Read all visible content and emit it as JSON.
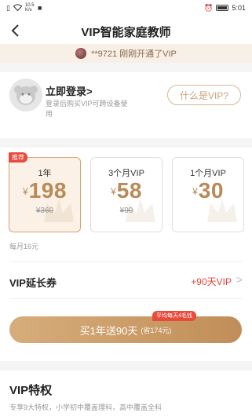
{
  "status_bar": {
    "left_icons": [
      "document-icon",
      "wifi-icon",
      "network-speed-icon",
      "notification-icon"
    ],
    "network_speed": "10.5\nK/s",
    "right_icons": [
      "alarm-icon",
      "battery-icon"
    ],
    "time": "5:01"
  },
  "header": {
    "title": "VIP智能家庭教师"
  },
  "notice": {
    "text": "**9721 刚刚开通了VIP"
  },
  "login": {
    "title": "立即登录>",
    "description": "登录后购买VIP可跨设备使用",
    "what_is_vip": "什么是VIP?"
  },
  "plans": [
    {
      "name": "1年",
      "currency": "¥",
      "price": "198",
      "original": "¥360",
      "badge": "推荐",
      "selected": true
    },
    {
      "name": "3个月VIP",
      "currency": "¥",
      "price": "58",
      "original": "¥90",
      "selected": false
    },
    {
      "name": "1个月VIP",
      "currency": "¥",
      "price": "30",
      "original": "",
      "selected": false
    }
  ],
  "per_month": "每月16元",
  "coupon": {
    "label": "VIP延长券",
    "value": "+90天VIP"
  },
  "buy": {
    "tip": "平均每天4毛钱",
    "label": "买1年送90天",
    "sub": "(省174元)"
  },
  "privileges": {
    "title": "VIP特权",
    "description": "专享9大特权，小学初中覆盖理科，高中覆盖全科"
  },
  "colors": {
    "accent": "#c9a47d",
    "price": "#b88a57",
    "red": "#e3443a",
    "badge": "#e84a3c"
  }
}
